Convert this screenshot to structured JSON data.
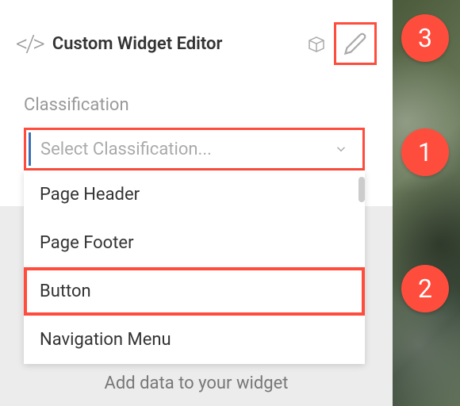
{
  "header": {
    "title": "Custom Widget Editor"
  },
  "classification": {
    "label": "Classification",
    "placeholder": "Select Classification...",
    "options": [
      {
        "label": "Page Header",
        "highlighted": false
      },
      {
        "label": "Page Footer",
        "highlighted": false
      },
      {
        "label": "Button",
        "highlighted": true
      },
      {
        "label": "Navigation Menu",
        "highlighted": false
      }
    ]
  },
  "bottom": {
    "text": "Add data to your widget"
  },
  "badges": {
    "one": "1",
    "two": "2",
    "three": "3"
  }
}
